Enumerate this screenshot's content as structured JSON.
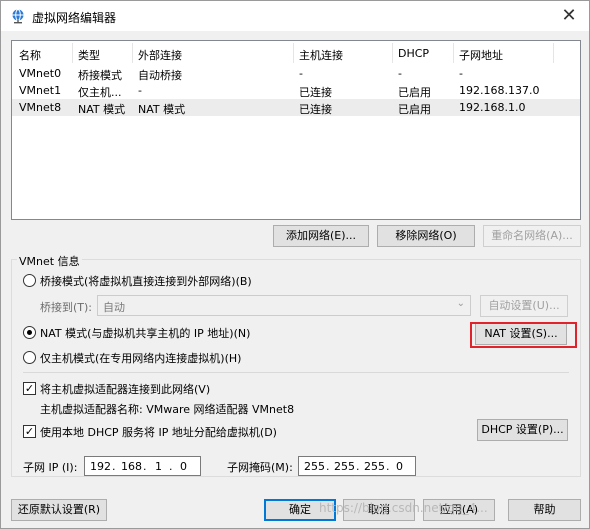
{
  "window": {
    "title": "虚拟网络编辑器",
    "close_glyph": "✕",
    "icon": "network-globe-icon"
  },
  "table": {
    "headers": [
      "名称",
      "类型",
      "外部连接",
      "主机连接",
      "DHCP",
      "子网地址"
    ],
    "rows": [
      [
        "VMnet0",
        "桥接模式",
        "自动桥接",
        "-",
        "-",
        "-"
      ],
      [
        "VMnet1",
        "仅主机...",
        "-",
        "已连接",
        "已启用",
        "192.168.137.0"
      ],
      [
        "VMnet8",
        "NAT 模式",
        "NAT 模式",
        "已连接",
        "已启用",
        "192.168.1.0"
      ]
    ],
    "selected_row": 2
  },
  "network_buttons": {
    "add": "添加网络(E)...",
    "remove": "移除网络(O)",
    "rename": "重命名网络(A)..."
  },
  "vmnet_info": {
    "group_title": "VMnet 信息",
    "bridge_mode": "桥接模式(将虚拟机直接连接到外部网络)(B)",
    "bridge_to_label": "桥接到(T):",
    "bridge_to_value": "自动",
    "auto_settings": "自动设置(U)...",
    "nat_mode": "NAT 模式(与虚拟机共享主机的 IP 地址)(N)",
    "nat_settings": "NAT 设置(S)...",
    "host_only_mode": "仅主机模式(在专用网络内连接虚拟机)(H)",
    "connect_adapter": "将主机虚拟适配器连接到此网络(V)",
    "adapter_name": "主机虚拟适配器名称: VMware 网络适配器 VMnet8",
    "use_dhcp": "使用本地 DHCP 服务将 IP 地址分配给虚拟机(D)",
    "dhcp_settings": "DHCP 设置(P)...",
    "subnet_ip_label": "子网 IP (I):",
    "subnet_ip": [
      "192",
      "168",
      "1",
      "0"
    ],
    "subnet_mask_label": "子网掩码(M):",
    "subnet_mask": [
      "255",
      "255",
      "255",
      "0"
    ],
    "selected_mode": "nat",
    "connect_adapter_checked": true,
    "use_dhcp_checked": true
  },
  "footer": {
    "restore": "还原默认设置(R)",
    "ok": "确定",
    "cancel": "取消",
    "apply": "应用(A)",
    "help": "帮助"
  },
  "watermark": "https://blog.csdn.net/qq_4..."
}
